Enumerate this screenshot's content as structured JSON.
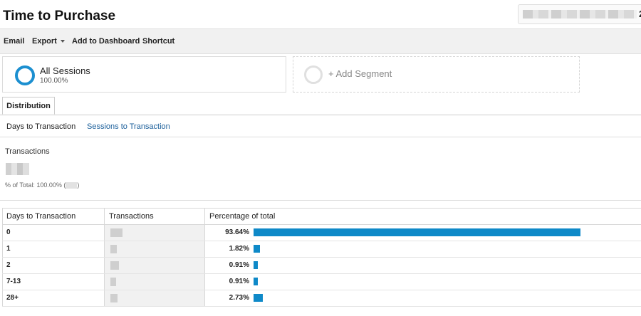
{
  "page": {
    "title": "Time to Purchase",
    "date_range_tail": "2"
  },
  "toolbar": {
    "email": "Email",
    "export": "Export",
    "add_to_dashboard": "Add to Dashboard",
    "shortcut": "Shortcut"
  },
  "segments": {
    "all_sessions": {
      "name": "All Sessions",
      "percent": "100.00%"
    },
    "add_segment": "+ Add Segment"
  },
  "tabs": {
    "distribution": "Distribution"
  },
  "subnav": {
    "active": "Days to Transaction",
    "link": "Sessions to Transaction"
  },
  "metric": {
    "label": "Transactions",
    "total_prefix": "% of Total: 100.00% (",
    "total_suffix": ")"
  },
  "table": {
    "headers": [
      "Days to Transaction",
      "Transactions",
      "Percentage of total"
    ],
    "rows": [
      {
        "days": "0",
        "percent_text": "93.64%",
        "percent": 93.64
      },
      {
        "days": "1",
        "percent_text": "1.82%",
        "percent": 1.82
      },
      {
        "days": "2",
        "percent_text": "0.91%",
        "percent": 0.91
      },
      {
        "days": "7-13",
        "percent_text": "0.91%",
        "percent": 0.91
      },
      {
        "days": "28+",
        "percent_text": "2.73%",
        "percent": 2.73
      }
    ]
  },
  "colors": {
    "bar": "#0e89c8",
    "segment_ring": "#1c8fd0",
    "link": "#1a5e9a"
  }
}
